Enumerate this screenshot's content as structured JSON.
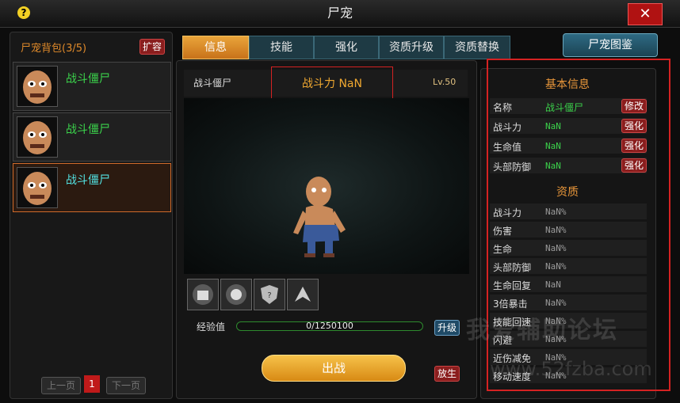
{
  "window": {
    "title": "尸宠",
    "help_glyph": "?",
    "close_glyph": "✕"
  },
  "bag": {
    "title": "尸宠背包(3/5)",
    "expand_label": "扩容",
    "items": [
      {
        "name": "战斗僵尸"
      },
      {
        "name": "战斗僵尸"
      },
      {
        "name": "战斗僵尸"
      }
    ],
    "prev_label": "上一页",
    "page": "1",
    "next_label": "下一页"
  },
  "tabs": [
    {
      "label": "信息"
    },
    {
      "label": "技能"
    },
    {
      "label": "强化"
    },
    {
      "label": "资质升级"
    },
    {
      "label": "资质替换"
    }
  ],
  "atlas_label": "尸宠图鉴",
  "pet": {
    "name": "战斗僵尸",
    "power": "战斗力 NaN",
    "level": "Lv.50",
    "exp_label": "经验值",
    "exp_text": "0/1250100",
    "exp_fraction": 0,
    "upgrade_label": "升级",
    "battle_label": "出战",
    "release_label": "放生"
  },
  "info": {
    "basic_title": "基本信息",
    "basic": [
      {
        "label": "名称",
        "value": "战斗僵尸",
        "button": "修改"
      },
      {
        "label": "战斗力",
        "value": "NaN",
        "button": "强化"
      },
      {
        "label": "生命值",
        "value": "NaN",
        "button": "强化"
      },
      {
        "label": "头部防御",
        "value": "NaN",
        "button": "强化"
      }
    ],
    "aptitude_title": "资质",
    "aptitude": [
      {
        "label": "战斗力",
        "value": "NaN%"
      },
      {
        "label": "伤害",
        "value": "NaN%"
      },
      {
        "label": "生命",
        "value": "NaN%"
      },
      {
        "label": "头部防御",
        "value": "NaN%"
      },
      {
        "label": "生命回复",
        "value": "NaN"
      },
      {
        "label": "3倍暴击",
        "value": "NaN%"
      },
      {
        "label": "技能回速",
        "value": "NaN%"
      },
      {
        "label": "闪避",
        "value": "NaN%"
      },
      {
        "label": "近伤减免",
        "value": "NaN%"
      },
      {
        "label": "移动速度",
        "value": "NaN%"
      }
    ]
  },
  "watermark": {
    "line1": "我爱辅助论坛",
    "line2": "www.52fzba.com"
  },
  "colors": {
    "accent": "#e9a43a",
    "name_green": "#3bd24b",
    "highlight": "#d42222"
  }
}
